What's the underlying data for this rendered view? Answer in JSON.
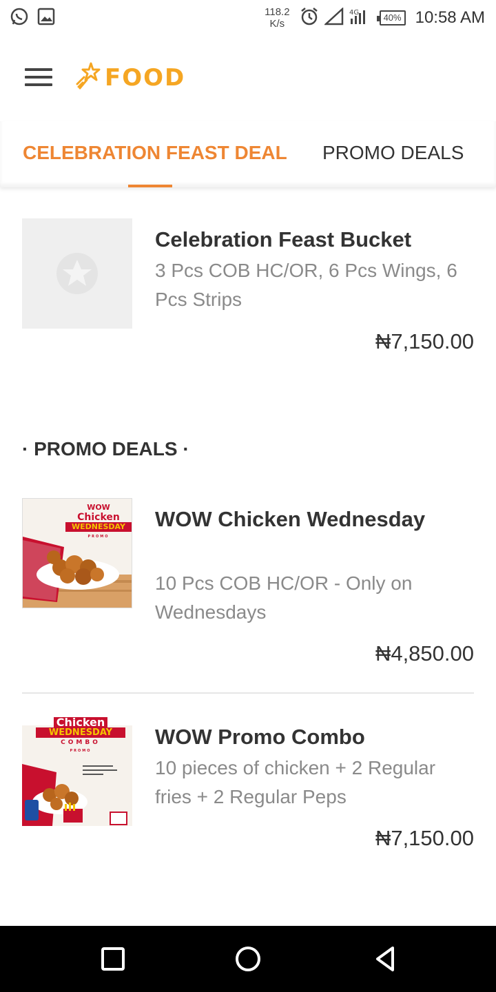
{
  "status_bar": {
    "speed_value": "118.2",
    "speed_unit": "K/s",
    "battery": "40%",
    "time": "10:58 AM",
    "icons": [
      "whatsapp-icon",
      "gallery-icon",
      "alarm-icon",
      "signal-icon",
      "4g-signal-icon",
      "battery-icon"
    ]
  },
  "app_bar": {
    "menu_icon": "hamburger-icon",
    "logo_text": "FOOD",
    "logo_color": "#f5a623"
  },
  "tabs": [
    {
      "label": "CELEBRATION FEAST DEAL",
      "active": true
    },
    {
      "label": "PROMO DEALS",
      "active": false
    }
  ],
  "accent_color": "#ee8633",
  "celebration_items": [
    {
      "title": "Celebration Feast Bucket",
      "description": "3 Pcs COB HC/OR, 6 Pcs Wings, 6 Pcs Strips",
      "price": "₦7,150.00"
    }
  ],
  "promo_section_title": "· PROMO DEALS ·",
  "promo_items": [
    {
      "title": "WOW Chicken Wednesday",
      "description": "10 Pcs COB HC/OR - Only on Wednesdays",
      "price": "₦4,850.00",
      "image_text": [
        "WOW",
        "Chicken",
        "WEDNESDAY",
        "PROMO"
      ]
    },
    {
      "title": "WOW Promo Combo",
      "description": "10 pieces of chicken + 2 Regular fries + 2 Regular Peps",
      "price": "₦7,150.00",
      "image_text": [
        "Chicken",
        "WEDNESDAY",
        "COMBO",
        "PROMO"
      ]
    }
  ],
  "nav_bar": {
    "icons": [
      "recents-icon",
      "home-icon",
      "back-icon"
    ]
  }
}
